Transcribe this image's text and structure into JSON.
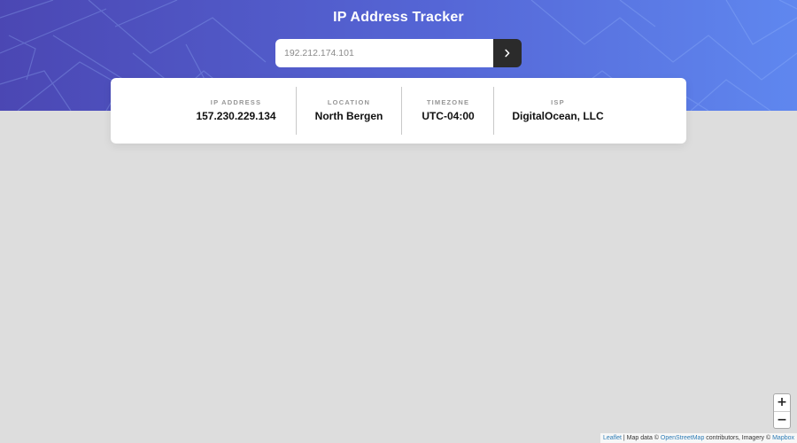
{
  "header": {
    "title": "IP Address Tracker",
    "gradient_start": "#4b47b3",
    "gradient_end": "#5f87ef"
  },
  "search": {
    "value": "",
    "placeholder": "192.212.174.101",
    "button_icon": "chevron-right-icon"
  },
  "info": {
    "ip": {
      "label": "IP ADDRESS",
      "value": "157.230.229.134"
    },
    "location": {
      "label": "LOCATION",
      "value": "North Bergen"
    },
    "timezone": {
      "label": "TIMEZONE",
      "value": "UTC-04:00"
    },
    "isp": {
      "label": "ISP",
      "value": "DigitalOcean, LLC"
    }
  },
  "map": {
    "zoom_in_label": "+",
    "zoom_out_label": "−",
    "attribution": {
      "leaflet": "Leaflet",
      "sep": " | Map data © ",
      "osm": "OpenStreetMap",
      "contributors": " contributors, Imagery © ",
      "mapbox": "Mapbox"
    }
  }
}
